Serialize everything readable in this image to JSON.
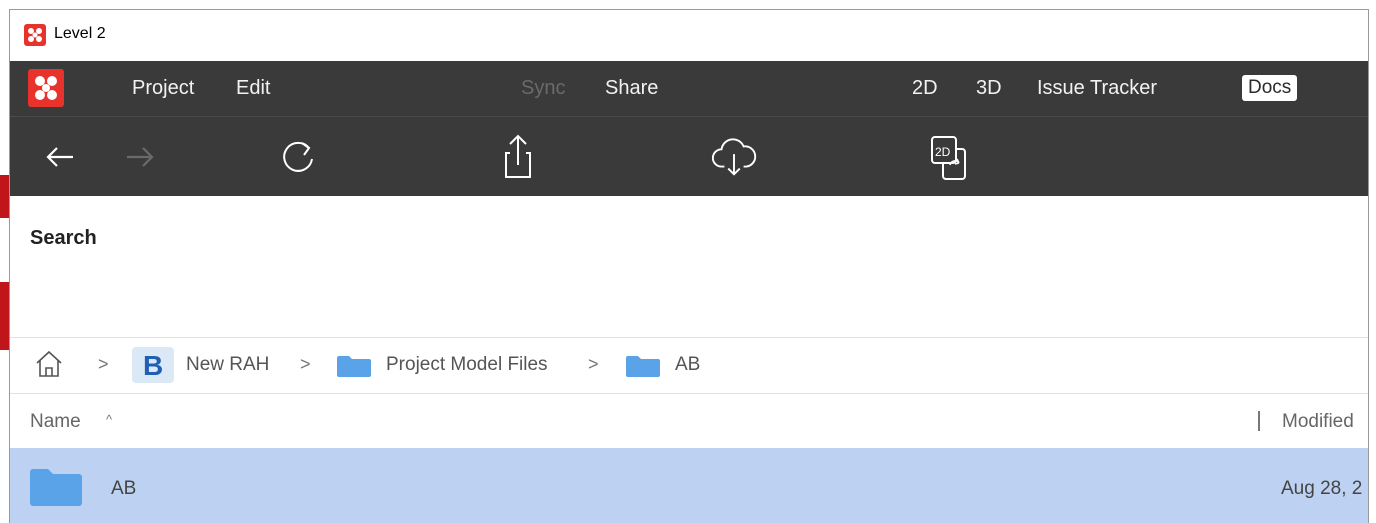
{
  "window": {
    "title": "Level 2"
  },
  "menubar": {
    "project": "Project",
    "edit": "Edit",
    "sync": "Sync",
    "share": "Share",
    "view_2d": "2D",
    "view_3d": "3D",
    "issue_tracker": "Issue Tracker",
    "docs": "Docs"
  },
  "toolbar": {
    "icons": [
      "back-arrow-icon",
      "forward-arrow-icon",
      "refresh-icon",
      "upload-icon",
      "cloud-download-icon",
      "2d-sheet-icon"
    ],
    "sheet_icon_text": "2D"
  },
  "search": {
    "label": "Search"
  },
  "breadcrumb": {
    "project_badge": "B",
    "project": "New RAH",
    "folder1": "Project Model Files",
    "folder2": "AB",
    "separator": ">"
  },
  "list": {
    "col_name": "Name",
    "sort_indicator": "^",
    "col_modified": "Modified",
    "rows": [
      {
        "name": "AB",
        "modified": "Aug 28, 2"
      }
    ]
  },
  "colors": {
    "accent": "#e8332c",
    "toolbar_bg": "#3a3a3a",
    "selection": "#bdd2f2",
    "folder": "#5aa3e8"
  }
}
